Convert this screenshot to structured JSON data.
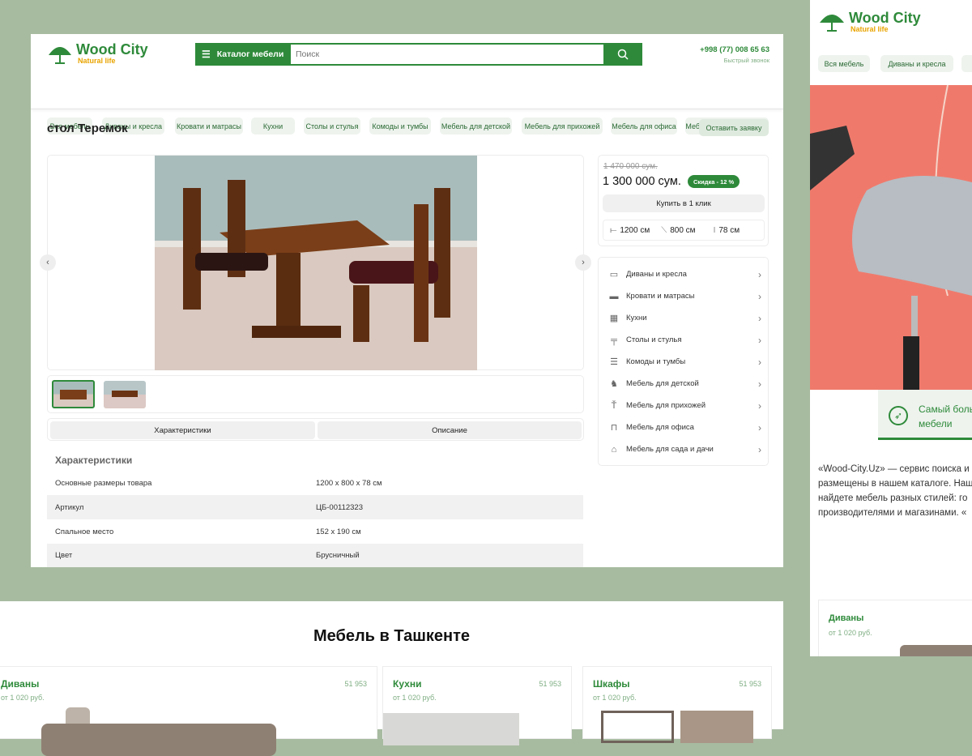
{
  "brand": {
    "name": "Wood City",
    "tagline": "Natural life"
  },
  "header": {
    "catalog_label": "Каталог мебели",
    "search_placeholder": "Поиск",
    "phone": "+998 (77) 008 65 63",
    "callback": "Быстрый звонок"
  },
  "nav": [
    "Вся мебель",
    "Диваны и кресла",
    "Кровати и матрасы",
    "Кухни",
    "Столы и стулья",
    "Комоды и тумбы",
    "Мебель для детской",
    "Мебель для прихожей",
    "Мебель для офиса",
    "Мебель для сада и дачи"
  ],
  "product": {
    "title": "стол Теремок",
    "request_button": "Оставить заявку",
    "old_price": "1 470 000 сум.",
    "price": "1 300 000 сум.",
    "discount": "Скидка - 12 %",
    "buy_button": "Купить в 1 клик",
    "width": "1200 см",
    "depth": "800 см",
    "height": "78 см"
  },
  "categories": [
    {
      "label": "Диваны и кресла",
      "icon": "sofa-icon"
    },
    {
      "label": "Кровати и матрасы",
      "icon": "bed-icon"
    },
    {
      "label": "Кухни",
      "icon": "kitchen-icon"
    },
    {
      "label": "Столы и стулья",
      "icon": "table-icon"
    },
    {
      "label": "Комоды и тумбы",
      "icon": "dresser-icon"
    },
    {
      "label": "Мебель для детской",
      "icon": "rocking-horse-icon"
    },
    {
      "label": "Мебель для прихожей",
      "icon": "coat-rack-icon"
    },
    {
      "label": "Мебель для офиса",
      "icon": "office-chair-icon"
    },
    {
      "label": "Мебель для сада и дачи",
      "icon": "garden-icon"
    }
  ],
  "tabs": [
    "Характеристики",
    "Описание"
  ],
  "specs": {
    "heading": "Характеристики",
    "rows": [
      {
        "name": "Основные размеры товара",
        "value": "1200 x 800 x 78 см"
      },
      {
        "name": "Артикул",
        "value": "ЦБ-00112323"
      },
      {
        "name": "Спальное место",
        "value": "152 x 190 см"
      },
      {
        "name": "Цвет",
        "value": "Брусничный"
      }
    ]
  },
  "section": {
    "title": "Мебель в Ташкенте",
    "cards": [
      {
        "name": "Диваны",
        "count": "51 953",
        "price": "от 1 020 руб."
      },
      {
        "name": "Кухни",
        "count": "51 953",
        "price": "от 1 020 руб."
      },
      {
        "name": "Шкафы",
        "count": "51 953",
        "price": "от 1 020 руб."
      }
    ]
  },
  "right": {
    "nav": [
      "Вся мебель",
      "Диваны и кресла"
    ],
    "banner_text": "Самый боль мебели",
    "about": "«Wood-City.Uz» — сервис поиска и размещены в нашем каталоге. Наш найдете мебель разных стилей: го производителями и магазинами. «",
    "card_name": "Диваны",
    "card_price": "от 1 020 руб."
  },
  "colors": {
    "brand": "#2e8a3a",
    "accent": "#e9a400",
    "background": "#a7bba0",
    "banner": "#ef7a6c"
  }
}
